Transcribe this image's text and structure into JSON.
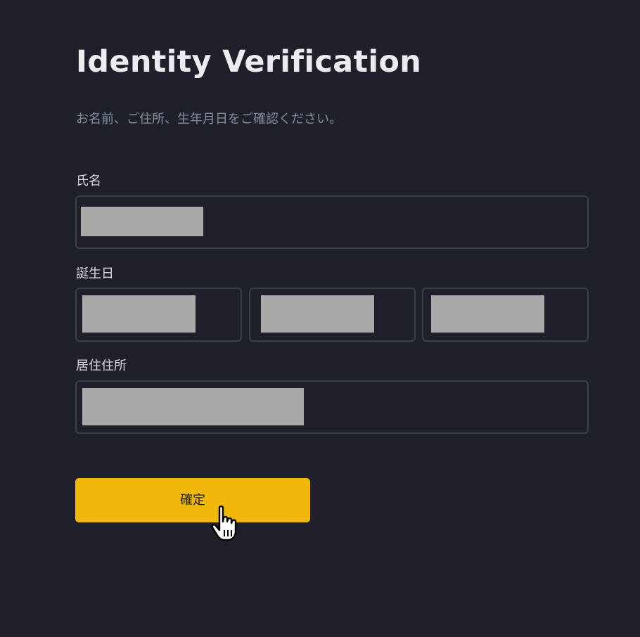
{
  "header": {
    "title": "Identity Verification",
    "subtitle": "お名前、ご住所、生年月日をご確認ください。"
  },
  "form": {
    "name_label": "氏名",
    "name_value": "",
    "birthday_label": "誕生日",
    "birthday_year_value": "",
    "birthday_month_value": "",
    "birthday_day_value": "",
    "address_label": "居住住所",
    "address_value": ""
  },
  "actions": {
    "confirm_label": "確定"
  },
  "colors": {
    "background": "#1e2129",
    "accent": "#efb80b",
    "redaction": "#a9a9a9"
  }
}
